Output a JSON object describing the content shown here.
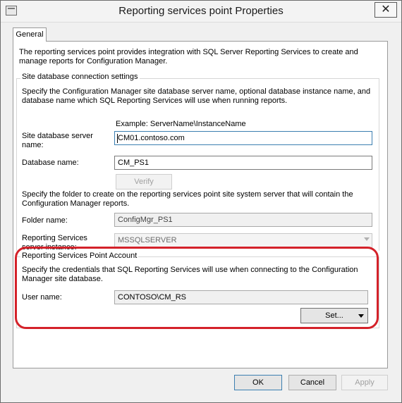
{
  "window": {
    "title": "Reporting services point Properties",
    "close_glyph": "✕"
  },
  "tabs": [
    {
      "label": "General"
    }
  ],
  "intro": "The reporting services point provides integration with SQL Server Reporting Services to create and manage reports for Configuration Manager.",
  "site_db": {
    "legend": "Site database connection settings",
    "description": "Specify the Configuration Manager site database server name, optional database instance name, and database name which SQL Reporting Services will use when running reports.",
    "example": "Example: ServerName\\InstanceName",
    "server_label_line1": "Site database server",
    "server_label_line2": "name:",
    "server_value": "CM01.contoso.com",
    "database_label": "Database name:",
    "database_value": "CM_PS1",
    "verify_label": "Verify",
    "folder_description": "Specify the folder to create on the reporting services point site system server that will contain the Configuration Manager reports.",
    "folder_label": "Folder name:",
    "folder_value": "ConfigMgr_PS1",
    "instance_label_line1": "Reporting Services",
    "instance_label_line2": "server instance:",
    "instance_value": "MSSQLSERVER"
  },
  "account": {
    "legend": "Reporting Services Point Account",
    "description": "Specify the credentials that SQL Reporting Services will use when connecting to the Configuration Manager site database.",
    "user_label": "User name:",
    "user_value": "CONTOSO\\CM_RS",
    "set_label": "Set..."
  },
  "footer": {
    "ok": "OK",
    "cancel": "Cancel",
    "apply": "Apply"
  },
  "colors": {
    "highlight": "#d4222a"
  }
}
